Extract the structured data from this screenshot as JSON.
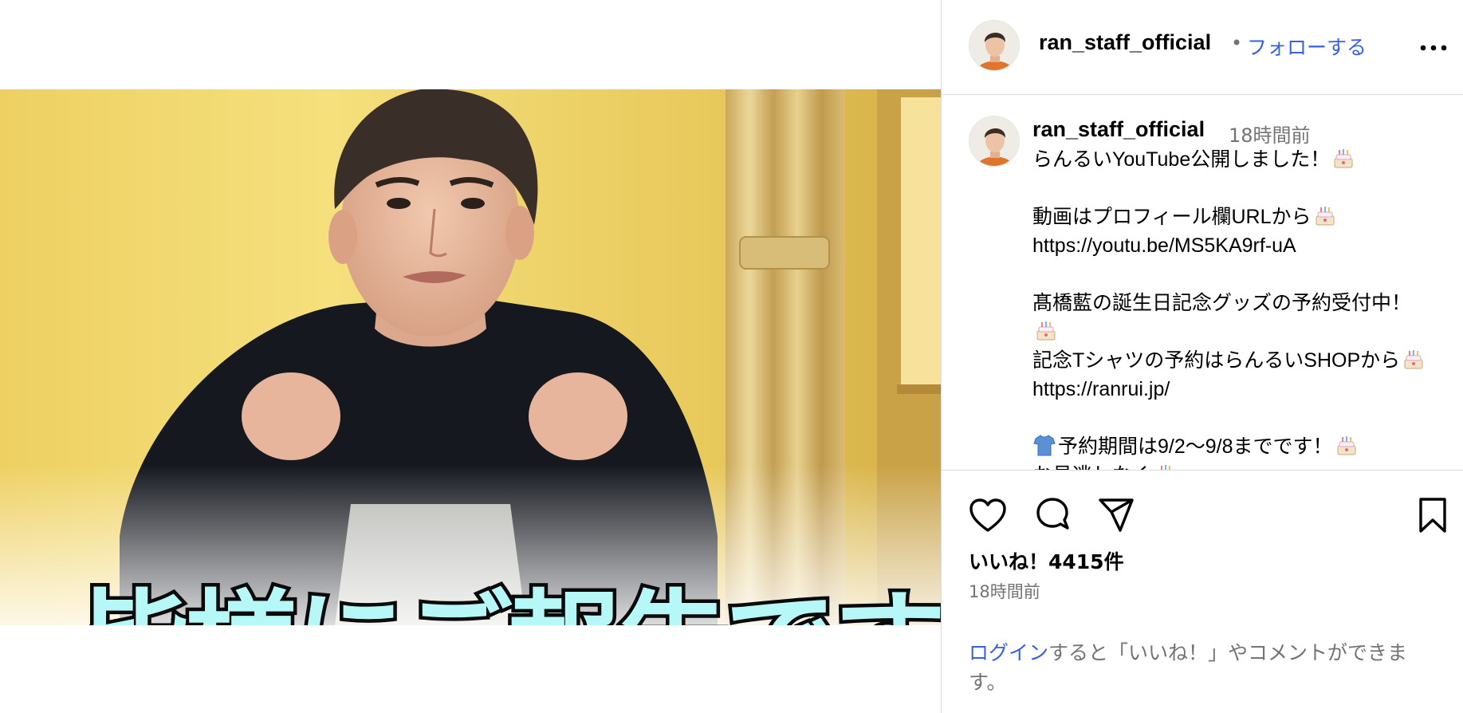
{
  "post": {
    "video_caption": "皆様にご報告です",
    "tag_icon": "person-icon"
  },
  "header": {
    "username": "ran_staff_official",
    "separator": "•",
    "follow_label": "フォローする",
    "more_icon": "more-horizontal-icon"
  },
  "caption": {
    "username": "ran_staff_official",
    "time": "18時間前",
    "lines": [
      "らんるいYouTube公開しました！",
      "",
      "動画はプロフィール欄URLから",
      "https://youtu.be/MS5KA9rf-uA",
      "",
      "髙橋藍の誕生日記念グッズの予約受付中！",
      "",
      "記念Tシャツの予約はらんるいSHOPから",
      "https://ranrui.jp/",
      "",
      "予約期間は9/2〜9/8までです！",
      "お見逃しなく"
    ],
    "emoji": "cake-icon",
    "emoji_shirt": "tshirt-icon"
  },
  "actions": {
    "like_icon": "heart-icon",
    "comment_icon": "comment-icon",
    "share_icon": "send-icon",
    "save_icon": "bookmark-icon"
  },
  "likes_text": "いいね！4415件",
  "post_time": "18時間前",
  "login": {
    "link_label": "ログイン",
    "rest_text": "すると「いいね！」やコメントができます。"
  }
}
